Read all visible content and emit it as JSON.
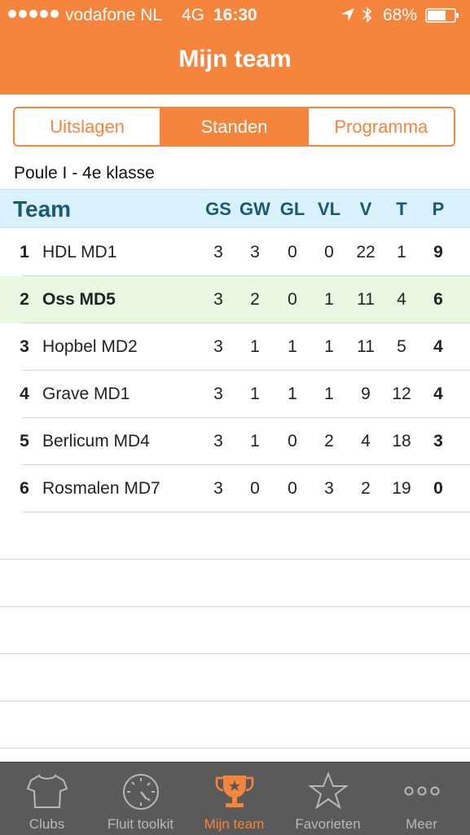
{
  "status_bar": {
    "carrier": "vodafone NL",
    "network": "4G",
    "time": "16:30",
    "battery": "68%"
  },
  "header": {
    "title": "Mijn team"
  },
  "segments": [
    {
      "label": "Uitslagen",
      "active": false
    },
    {
      "label": "Standen",
      "active": true
    },
    {
      "label": "Programma",
      "active": false
    }
  ],
  "poule": "Poule I - 4e klasse",
  "table": {
    "team_header": "Team",
    "columns": [
      "GS",
      "GW",
      "GL",
      "VL",
      "V",
      "T",
      "P"
    ],
    "rows": [
      {
        "pos": "1",
        "name": "HDL MD1",
        "gs": "3",
        "gw": "3",
        "gl": "0",
        "vl": "0",
        "v": "22",
        "t": "1",
        "p": "9"
      },
      {
        "pos": "2",
        "name": "Oss MD5",
        "gs": "3",
        "gw": "2",
        "gl": "0",
        "vl": "1",
        "v": "11",
        "t": "4",
        "p": "6",
        "highlight": true
      },
      {
        "pos": "3",
        "name": "Hopbel MD2",
        "gs": "3",
        "gw": "1",
        "gl": "1",
        "vl": "1",
        "v": "11",
        "t": "5",
        "p": "4"
      },
      {
        "pos": "4",
        "name": "Grave MD1",
        "gs": "3",
        "gw": "1",
        "gl": "1",
        "vl": "1",
        "v": "9",
        "t": "12",
        "p": "4"
      },
      {
        "pos": "5",
        "name": "Berlicum MD4",
        "gs": "3",
        "gw": "1",
        "gl": "0",
        "vl": "2",
        "v": "4",
        "t": "18",
        "p": "3"
      },
      {
        "pos": "6",
        "name": "Rosmalen MD7",
        "gs": "3",
        "gw": "0",
        "gl": "0",
        "vl": "3",
        "v": "2",
        "t": "19",
        "p": "0"
      }
    ]
  },
  "tabbar": [
    {
      "label": "Clubs",
      "icon": "shirt-icon"
    },
    {
      "label": "Fluit toolkit",
      "icon": "stopwatch-icon"
    },
    {
      "label": "Mijn team",
      "icon": "trophy-icon",
      "active": true
    },
    {
      "label": "Favorieten",
      "icon": "star-icon"
    },
    {
      "label": "Meer",
      "icon": "more-icon"
    }
  ],
  "colors": {
    "accent": "#f5843c",
    "header_bg": "#d9f1fb",
    "highlight_row": "#eaf8e2",
    "tabbar_bg": "#5a5a5a"
  }
}
